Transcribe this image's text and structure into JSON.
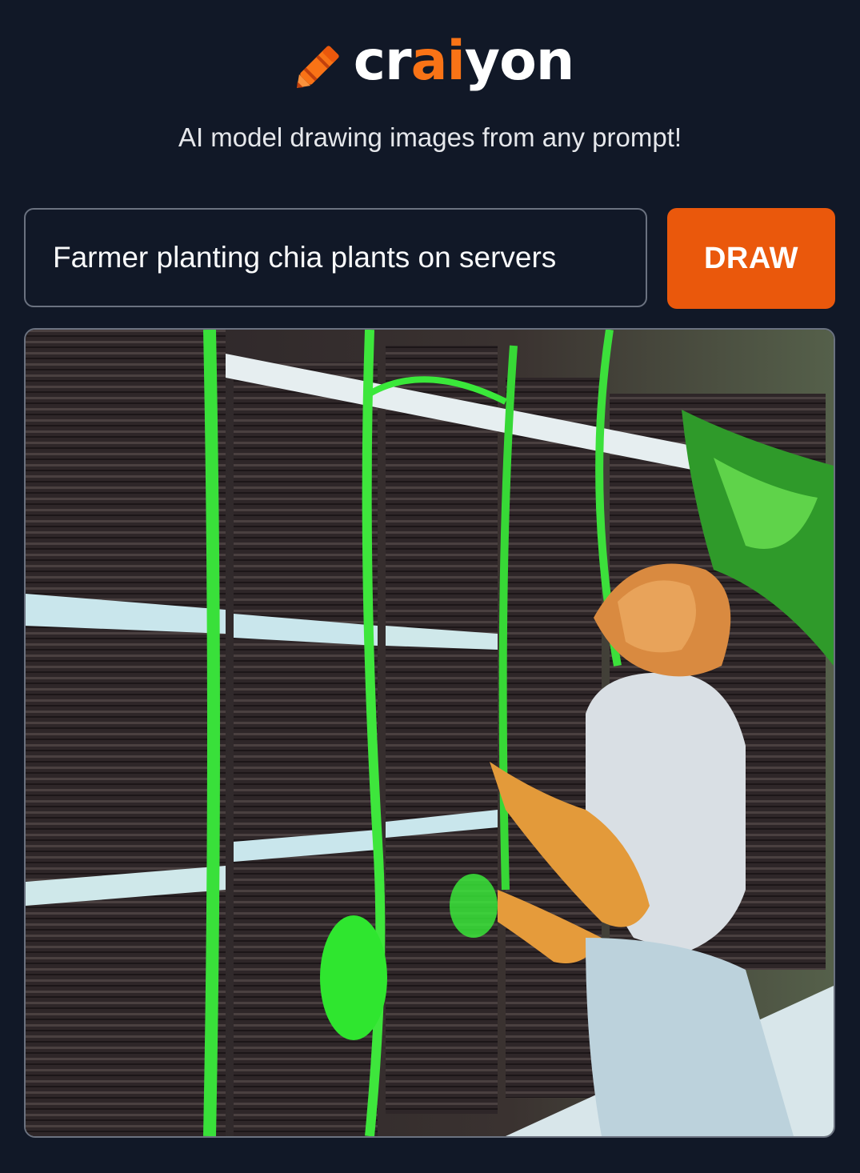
{
  "brand": {
    "logo_parts": {
      "before": "cr",
      "accent": "ai",
      "after": "yon"
    },
    "logo_icon": "crayon-icon",
    "accent_color": "#f97316",
    "tagline": "AI model drawing images from any prompt!"
  },
  "prompt": {
    "value": "Farmer planting chia plants on servers",
    "placeholder": ""
  },
  "draw_button": {
    "label": "DRAW",
    "color": "#ea580c"
  },
  "result": {
    "alt": "Farmer planting chia plants on servers"
  },
  "colors": {
    "background": "#111827",
    "border": "#6b7280"
  }
}
